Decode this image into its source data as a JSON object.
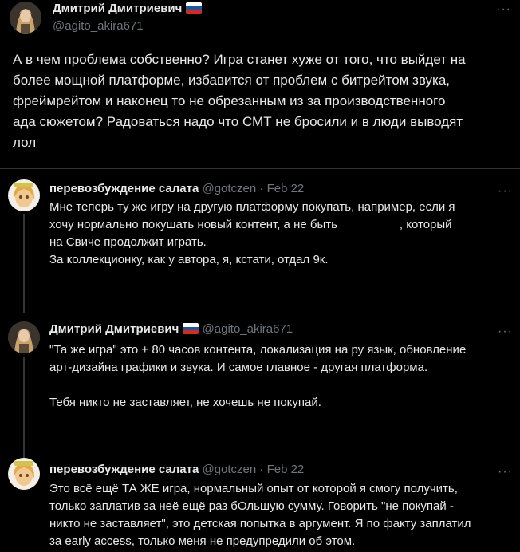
{
  "main_tweet": {
    "author_name": "Дмитрий Дмитриевич",
    "handle": "@agito_akira671",
    "more_label": "···",
    "text": "А в чем проблема собственно? Игра станет хуже от того, что выйдет на\nболее мощной платформе, избавится от проблем с битрейтом звука,\nфреймрейтом и наконец то не обрезанным из за производственного\nада сюжетом? Радоваться надо что СМТ не бросили и в люди выводят\nлол"
  },
  "replies": [
    {
      "author_name": "перевозбуждение салата",
      "handle": "@gotczen",
      "separator": "·",
      "date": "Feb 22",
      "more_label": "···",
      "text_a": "Мне теперь ту же игру на другую платформу покупать, например, если я\nхочу нормально покушать новый контент, а не быть",
      "text_b": ", который\nна Свиче продолжит играть.\nЗа коллекционку, как у автора, я, кстати, отдал 9к."
    },
    {
      "author_name": "Дмитрий Дмитриевич",
      "handle": "@agito_akira671",
      "more_label": "···",
      "text": "\"Та же игра\" это + 80 часов контента, локализация на ру язык, обновление\nарт-дизайна графики и звука. И самое главное - другая платформа.\n\nТебя никто не заставляет, не хочешь не покупай."
    },
    {
      "author_name": "перевозбуждение салата",
      "handle": "@gotczen",
      "separator": "·",
      "date": "Feb 22",
      "more_label": "···",
      "text": "Это всё ещё ТА ЖЕ игра, нормальный опыт от которой я смогу получить,\nтолько заплатив за неё ещё раз бОльшую сумму. Говорить \"не покупай -\nникто не заставляет\", это детская попытка в аргумент. Я по факту заплатил\nза early access, только меня не предупредили об этом."
    }
  ],
  "colors": {
    "background": "#000000",
    "text": "#e7e9ea",
    "secondary": "#71767b",
    "border": "#2f3336",
    "flag_white": "#ffffff",
    "flag_blue": "#1c57a5",
    "flag_red": "#d52b1e"
  }
}
